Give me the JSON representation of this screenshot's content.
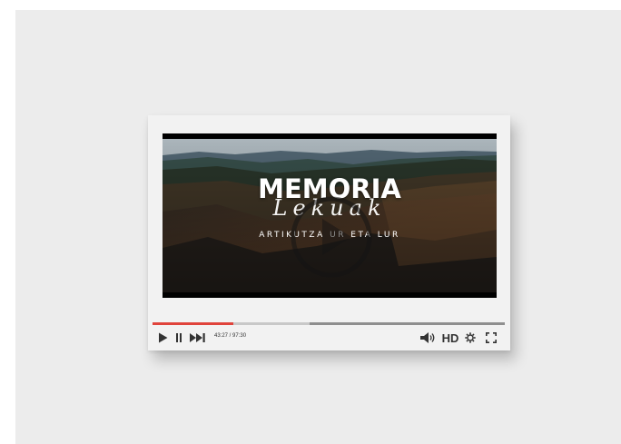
{
  "video": {
    "title": "MEMORIA",
    "script_title": "Lekuak",
    "subtitle": "ARTIKUTZA  UR ETA LUR"
  },
  "player": {
    "current_time": "43:27",
    "duration": "97:30",
    "separator": " / ",
    "progress_fraction": 0.446,
    "buffered_fraction": 0.229,
    "hd_label": "HD",
    "accent_color": "#e0443c"
  },
  "icons": {
    "play": "play-icon",
    "pause": "pause-icon",
    "next": "skip-next-icon",
    "volume": "volume-icon",
    "settings": "gear-icon",
    "fullscreen": "fullscreen-icon",
    "big_play": "big-play-icon"
  }
}
